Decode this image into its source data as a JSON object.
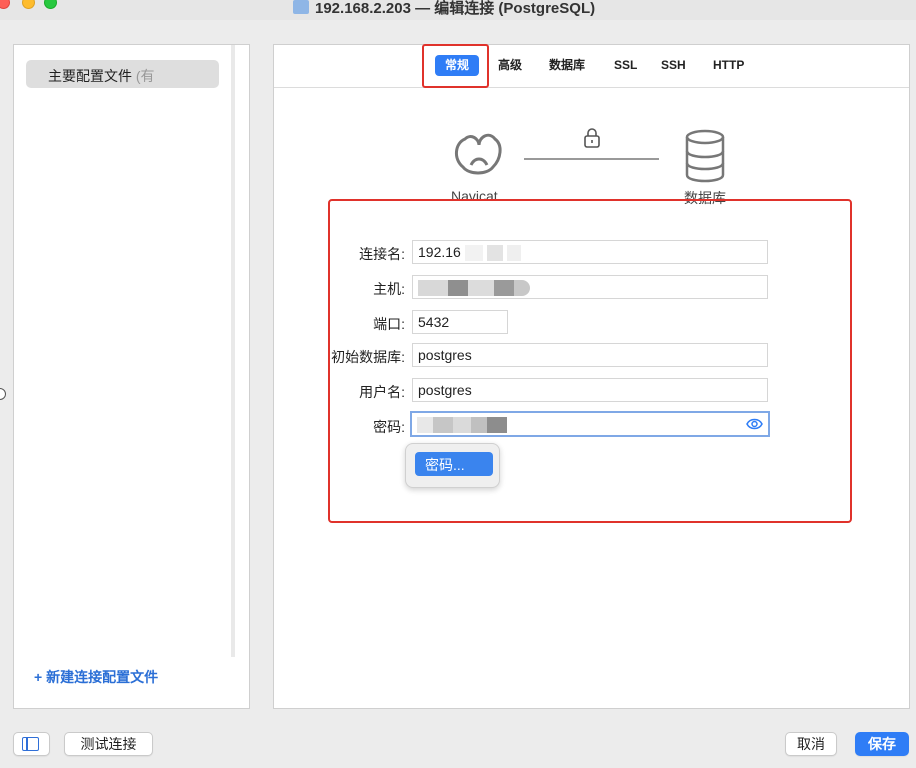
{
  "window": {
    "title": "192.168.2.203 — 编辑连接 (PostgreSQL)"
  },
  "sidebar": {
    "profile_item": "主要配置文件",
    "profile_item_suffix": "(有",
    "new_profile_label": "+ 新建连接配置文件"
  },
  "tabs": [
    {
      "label": "常规",
      "active": true
    },
    {
      "label": "高级",
      "active": false
    },
    {
      "label": "数据库",
      "active": false
    },
    {
      "label": "SSL",
      "active": false
    },
    {
      "label": "SSH",
      "active": false
    },
    {
      "label": "HTTP",
      "active": false
    }
  ],
  "diagram": {
    "navicat_label": "Navicat",
    "db_label": "数据库"
  },
  "form": {
    "connection_name_label": "连接名:",
    "connection_name_value": "192.16",
    "host_label": "主机:",
    "port_label": "端口:",
    "port_value": "5432",
    "initial_db_label": "初始数据库:",
    "initial_db_value": "postgres",
    "username_label": "用户名:",
    "username_value": "postgres",
    "password_label": "密码:"
  },
  "popup": {
    "password_item": "密码..."
  },
  "footer": {
    "test_connection": "测试连接",
    "cancel": "取消",
    "save": "保存"
  },
  "colors": {
    "accent": "#2f7df6",
    "highlight_red": "#e0322b"
  }
}
